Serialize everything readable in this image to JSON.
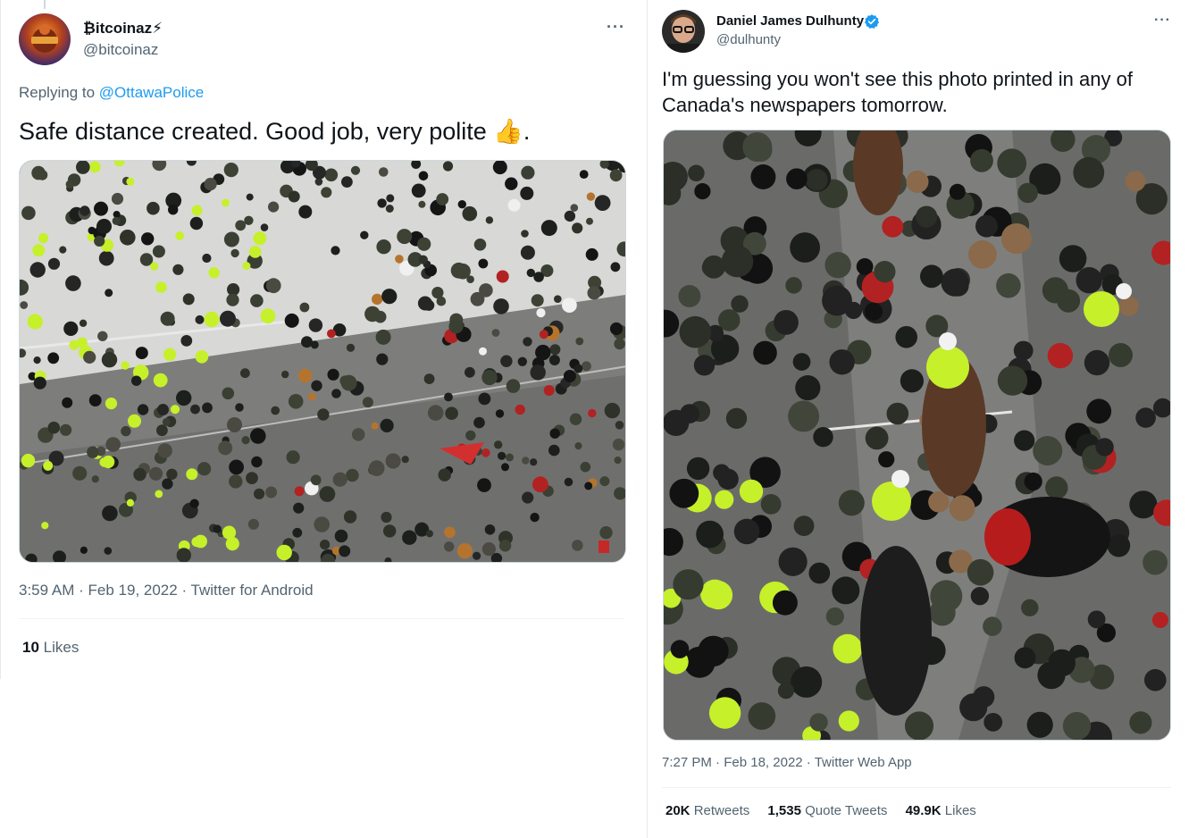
{
  "left_tweet": {
    "display_name": "₿itcoinaz⚡",
    "handle": "@bitcoinaz",
    "more_icon": "more-horizontal-icon",
    "replying_to_label": "Replying to",
    "replying_to_handle": "@OttawaPolice",
    "text": "Safe distance created. Good job, very polite 👍.",
    "photo_icon": "crowd-photo",
    "time": "3:59 AM",
    "separator": "·",
    "date": "Feb 19, 2022",
    "source": "Twitter for Android",
    "likes_count": "10",
    "likes_label": "Likes"
  },
  "right_tweet": {
    "display_name": "Daniel James Dulhunty",
    "verified_icon": "verified-badge-icon",
    "handle": "@dulhunty",
    "more_icon": "more-horizontal-icon",
    "text": "I'm guessing you won't see this photo printed in any of Canada's newspapers tomorrow.",
    "photo_icon": "crowd-closeup-photo",
    "time": "7:27 PM",
    "separator": "·",
    "date": "Feb 18, 2022",
    "source": "Twitter Web App",
    "retweets_count": "20K",
    "retweets_label": "Retweets",
    "quote_count": "1,535",
    "quote_label": "Quote Tweets",
    "likes_count": "49.9K",
    "likes_label": "Likes"
  },
  "colors": {
    "link": "#1d9bf0",
    "secondary_text": "#536471",
    "primary_text": "#0f1419",
    "verified": "#1d9bf0",
    "hi_vis": "#c6f02a"
  }
}
